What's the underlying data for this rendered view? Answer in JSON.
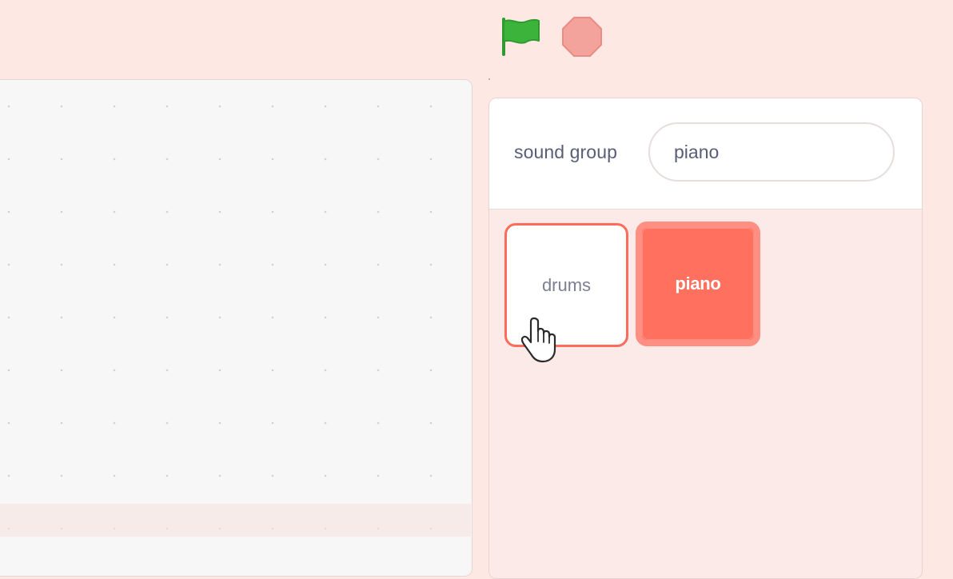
{
  "toolbar": {
    "green_flag_icon": "green-flag-icon",
    "stop_icon": "stop-icon",
    "colors": {
      "flag": "#3cb43c",
      "stop": "#f4a29c"
    }
  },
  "panel": {
    "sound_group_label": "sound group",
    "sound_group_value": "piano",
    "tiles": [
      {
        "label": "drums",
        "selected": false
      },
      {
        "label": "piano",
        "selected": true
      }
    ]
  },
  "colors": {
    "accent": "#ff705e",
    "page_background": "#fde8e4",
    "text": "#575e75"
  }
}
